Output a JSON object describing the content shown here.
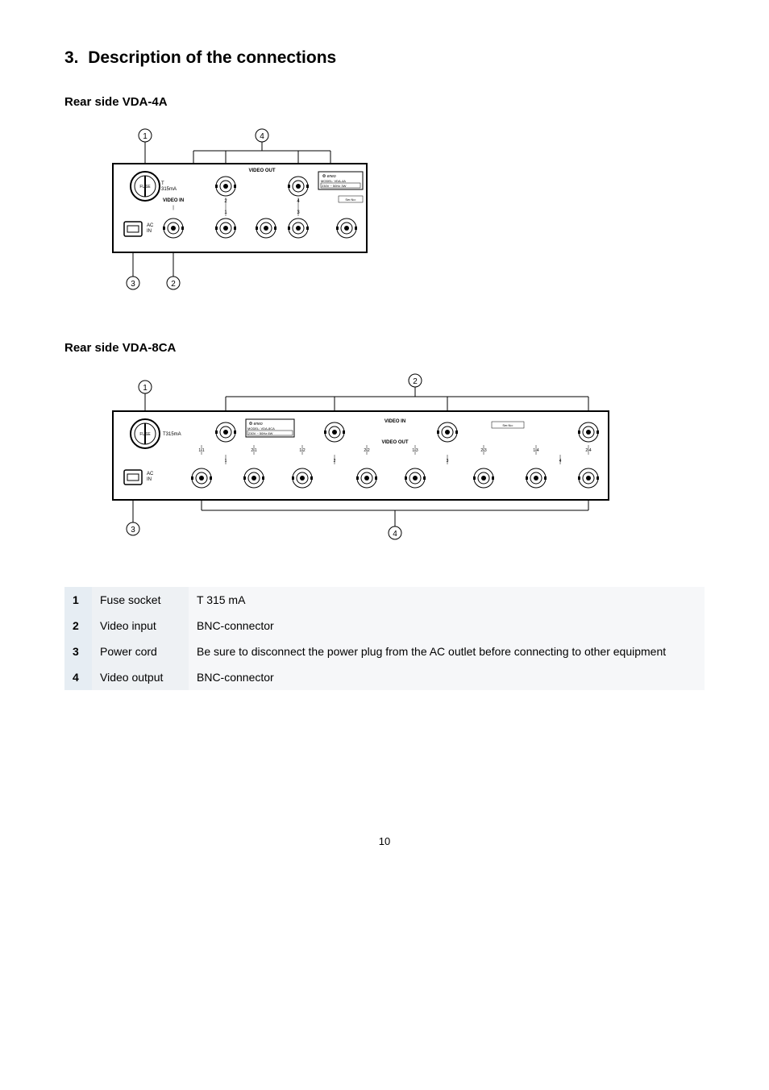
{
  "section_number": "3.",
  "section_title": "Description of the connections",
  "subhead_4a": "Rear side VDA-4A",
  "subhead_8ca": "Rear side VDA-8CA",
  "diagram4a": {
    "video_out": "VIDEO OUT",
    "video_in": "VIDEO IN",
    "fuse": "FUSE",
    "fuse_rating": "T\n315mA",
    "ac_in": "AC\nIN",
    "model_brand": "eneo",
    "model_line": "MODEL: VDA-4A",
    "model_power": "230V ~ 50Hz   3W",
    "ser_no": "Ser.No:",
    "port_numbers": [
      "1",
      "2",
      "3",
      "4"
    ],
    "callouts": {
      "c1": "1",
      "c2": "2",
      "c3": "3",
      "c4": "4"
    }
  },
  "diagram8ca": {
    "video_in": "VIDEO IN",
    "video_out": "VIDEO OUT",
    "fuse": "FUSE",
    "fuse_rating": "T315mA",
    "ac_in": "AC\nIN",
    "model_brand": "eneo",
    "model_line": "MODEL: VDA-8CA",
    "model_power": "230V ~ 50Hz   6W",
    "ser_no": "Ser.No:",
    "top_labels": [
      "1-1",
      "2-1",
      "1-2",
      "2-2",
      "1-3",
      "2-3",
      "1-4",
      "2-4"
    ],
    "bottom_labels": [
      "1",
      "2",
      "3",
      "4"
    ],
    "callouts": {
      "c1": "1",
      "c2": "2",
      "c3": "3",
      "c4": "4"
    }
  },
  "table": {
    "rows": [
      {
        "num": "1",
        "name": "Fuse socket",
        "desc": "T 315 mA"
      },
      {
        "num": "2",
        "name": "Video input",
        "desc": "BNC-connector"
      },
      {
        "num": "3",
        "name": "Power cord",
        "desc": "Be sure to disconnect the power plug from the AC outlet before connecting to other equipment"
      },
      {
        "num": "4",
        "name": "Video output",
        "desc": "BNC-connector"
      }
    ]
  },
  "page_number": "10"
}
